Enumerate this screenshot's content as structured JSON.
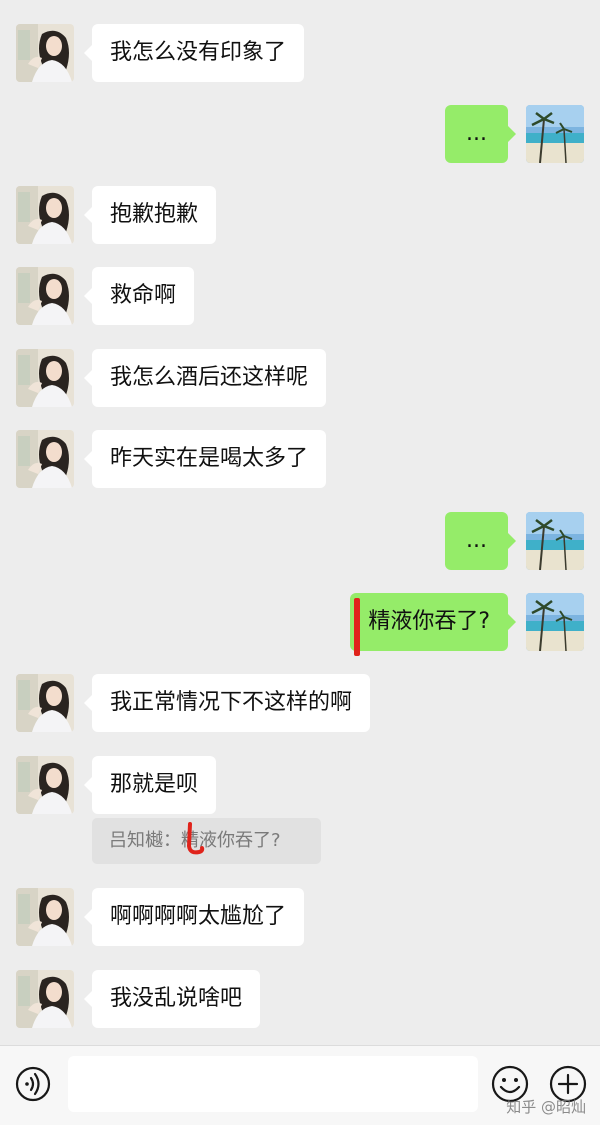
{
  "messages": [
    {
      "side": "in",
      "text": "我怎么没有印象了"
    },
    {
      "side": "out",
      "text": "..."
    },
    {
      "side": "in",
      "text": "抱歉抱歉"
    },
    {
      "side": "in",
      "text": "救命啊"
    },
    {
      "side": "in",
      "text": "我怎么酒后还这样呢"
    },
    {
      "side": "in",
      "text": "昨天实在是喝太多了"
    },
    {
      "side": "out",
      "text": "..."
    },
    {
      "side": "out",
      "text": "精液你吞了?"
    },
    {
      "side": "in",
      "text": "我正常情况下不这样的啊"
    },
    {
      "side": "in",
      "text": "那就是呗"
    },
    {
      "side": "in",
      "text": "啊啊啊啊太尴尬了"
    },
    {
      "side": "in",
      "text": "我没乱说啥吧"
    }
  ],
  "quote": {
    "text": "吕知樾：精液你吞了?"
  },
  "inputbar": {
    "voice_icon": "voice-icon",
    "emoji_icon": "emoji-icon",
    "plus_icon": "plus-icon"
  },
  "watermark": {
    "text": "知乎 @昭灿"
  },
  "colors": {
    "background": "#ededed",
    "incoming_bubble": "#ffffff",
    "outgoing_bubble": "#95ec69",
    "annotation": "#e0231b"
  }
}
